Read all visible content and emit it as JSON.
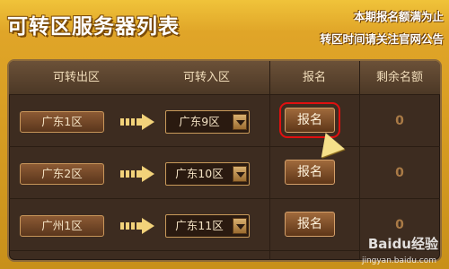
{
  "header": {
    "title": "可转区服务器列表",
    "notice_line1": "本期报名额满为止",
    "notice_line2": "转区时间请关注官网公告"
  },
  "table": {
    "columns": [
      "可转出区",
      "可转入区",
      "报名",
      "剩余名额"
    ],
    "rows": [
      {
        "from": "广东1区",
        "to": "广东9区",
        "action": "报名",
        "remaining": "0",
        "highlighted": true
      },
      {
        "from": "广东2区",
        "to": "广东10区",
        "action": "报名",
        "remaining": "0",
        "highlighted": false
      },
      {
        "from": "广州1区",
        "to": "广东11区",
        "action": "报名",
        "remaining": "0",
        "highlighted": false
      }
    ]
  },
  "watermark": {
    "text": "Baidu经验",
    "sub": "jingyan.baidu.com"
  },
  "colors": {
    "accent": "#e0a528",
    "panel": "#3d2c20",
    "highlight": "#e01010"
  }
}
